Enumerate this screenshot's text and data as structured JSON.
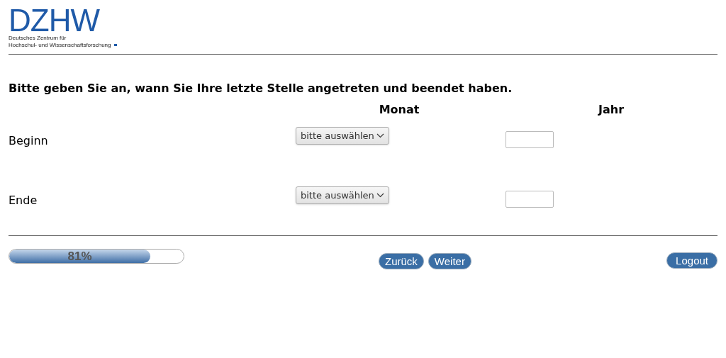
{
  "logo": {
    "mark": "DZHW",
    "lines": [
      "Deutsches Zentrum für",
      "Hochschul- und Wissenschaftsforschung"
    ]
  },
  "question": "Bitte geben Sie an, wann Sie Ihre letzte Stelle angetreten und beendet haben.",
  "columns": [
    "Monat",
    "Jahr"
  ],
  "rows": [
    {
      "label": "Beginn",
      "month": "bitte auswählen"
    },
    {
      "label": "Ende",
      "month": "bitte auswählen"
    }
  ],
  "progress": {
    "level": 0.81,
    "reading": "81%"
  },
  "buttons": [
    "Zurück",
    "Weiter"
  ],
  "logout": "Logout"
}
